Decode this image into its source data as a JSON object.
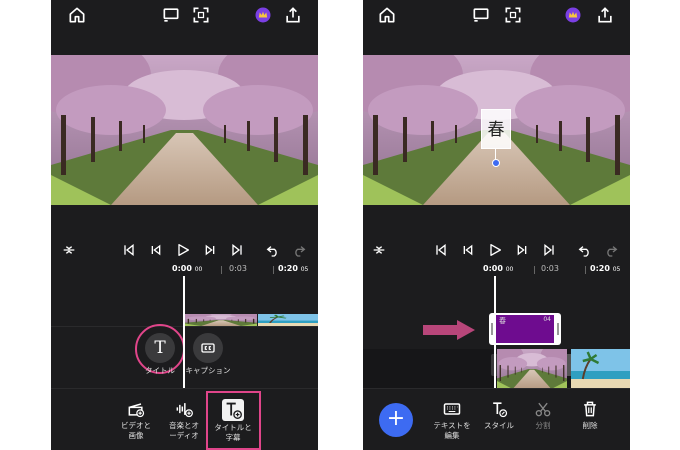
{
  "left": {
    "timecode": {
      "current": "0:00",
      "current_frames": "00",
      "t1": "0:03",
      "end": "0:20",
      "end_frames": "05"
    },
    "submenu": {
      "title_label": "タイトル",
      "title_glyph": "T",
      "caption_label": "キャプション"
    },
    "toolbar": {
      "video_label": "ビデオと\n画像",
      "music_label": "音楽とオ\nーディオ",
      "title_label": "タイトルと\n字幕"
    }
  },
  "right": {
    "timecode": {
      "current": "0:00",
      "current_frames": "00",
      "t1": "0:03",
      "end": "0:20",
      "end_frames": "05"
    },
    "overlay_text": "春",
    "title_clip": {
      "label": "春",
      "duration": "04"
    },
    "toolbar": {
      "add_glyph": "+",
      "keyboard_label": "テキストを\n編集",
      "style_label": "スタイル",
      "split_label": "分割",
      "delete_label": "削除"
    }
  },
  "colors": {
    "accent_pink": "#e0458a",
    "title_clip": "#6e0c8f",
    "add_button": "#3d6bf2",
    "premium": "#7b3fe4",
    "background": "#1c1c1e"
  }
}
